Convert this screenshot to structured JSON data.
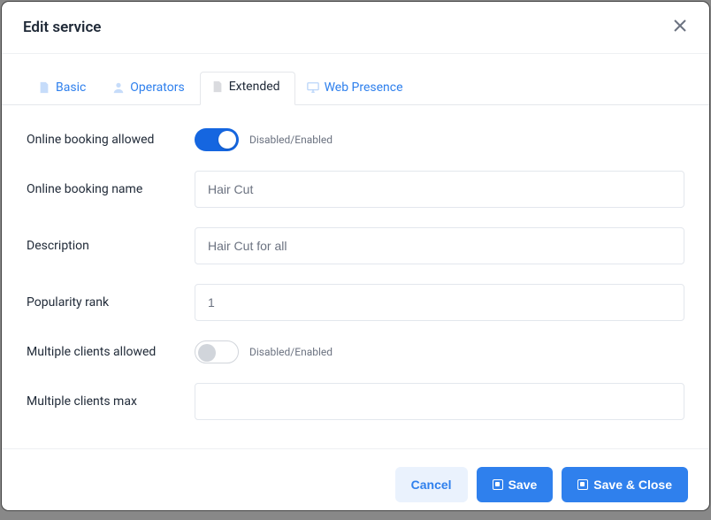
{
  "colors": {
    "primary": "#2f80ed"
  },
  "header": {
    "title": "Edit service"
  },
  "tabs": {
    "items": [
      {
        "label": "Basic",
        "icon": "file-icon"
      },
      {
        "label": "Operators",
        "icon": "user-icon"
      },
      {
        "label": "Extended",
        "icon": "file-icon",
        "active": true
      },
      {
        "label": "Web Presence",
        "icon": "monitor-icon"
      }
    ]
  },
  "form": {
    "online_booking_allowed": {
      "label": "Online booking allowed",
      "value": true,
      "hint": "Disabled/Enabled"
    },
    "online_booking_name": {
      "label": "Online booking name",
      "value": "Hair Cut"
    },
    "description": {
      "label": "Description",
      "value": "Hair Cut for all"
    },
    "popularity_rank": {
      "label": "Popularity rank",
      "value": "1"
    },
    "multiple_clients_allowed": {
      "label": "Multiple clients allowed",
      "value": false,
      "hint": "Disabled/Enabled"
    },
    "multiple_clients_max": {
      "label": "Multiple clients max",
      "value": ""
    }
  },
  "footer": {
    "cancel": "Cancel",
    "save": "Save",
    "save_close": "Save & Close"
  }
}
